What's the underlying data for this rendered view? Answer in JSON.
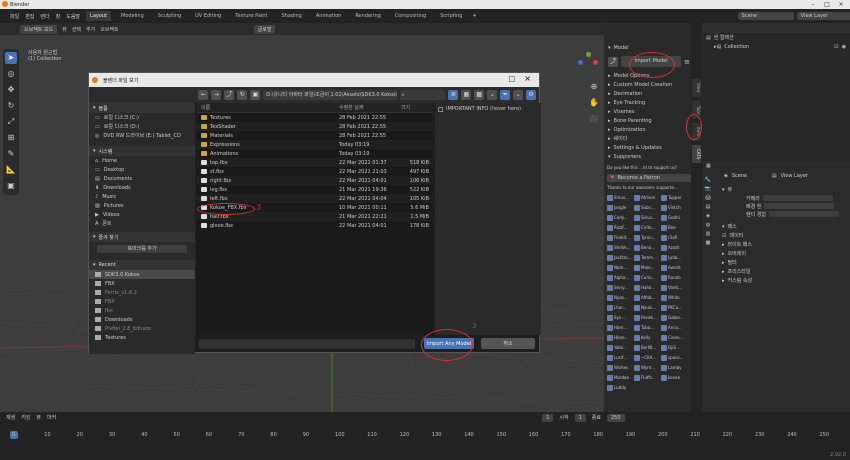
{
  "app": {
    "title": "Blender"
  },
  "menu": {
    "items": [
      "파일",
      "편집",
      "렌더",
      "창",
      "도움말"
    ],
    "tabs": [
      "Layout",
      "Modeling",
      "Sculpting",
      "UV Editing",
      "Texture Paint",
      "Shading",
      "Animation",
      "Rendering",
      "Compositing",
      "Scripting"
    ],
    "active": "Layout",
    "scene": "Scene",
    "view_layer": "View Layer"
  },
  "viewport": {
    "header": [
      "오브젝트 모드",
      "뷰",
      "선택",
      "추가",
      "오브젝트",
      "글로벌"
    ],
    "label_line1": "사용자 원근법",
    "label_line2": "(1) Collection"
  },
  "toolbar_icons": [
    "select-icon",
    "cursor-icon",
    "move-icon",
    "rotate-icon",
    "scale-icon",
    "transform-icon",
    "annotate-icon",
    "measure-icon",
    "add-cube-icon"
  ],
  "dialog": {
    "title": "블렌더 파일 보기",
    "path": "D:\\유니티 아바타 파일\\조금이 1.01\\Assets\\SDK3.0 Kokos\\",
    "side_sections": {
      "volumes": "볼륨",
      "system": "시스템",
      "favorites": "즐겨 찾기",
      "add_favorite": "북마크를 추가",
      "recent": "Recent"
    },
    "volumes": [
      "로컬 디스크 (C:)",
      "로컬 디스크 (D:)",
      "DVD RW 드라이브 (E:) Tablet_CD"
    ],
    "system": [
      "Home",
      "Desktop",
      "Documents",
      "Downloads",
      "Music",
      "Pictures",
      "Videos",
      "폰트"
    ],
    "recent": [
      "SDK3.0 Kokos",
      "FBX",
      "Ferris_v1.8.2",
      "FBX",
      "fbx",
      "Downloads",
      "Pivfiel_2.8_bdnaze",
      "Textures"
    ],
    "columns": {
      "name": "이름",
      "date": "수정한 날짜",
      "size": "크기"
    },
    "files": [
      {
        "name": "Textures",
        "date": "28 Feb 2021 22:55",
        "size": "",
        "type": "folder"
      },
      {
        "name": "TexShader",
        "date": "28 Feb 2021 22:55",
        "size": "",
        "type": "folder"
      },
      {
        "name": "Materials",
        "date": "28 Feb 2021 22:55",
        "size": "",
        "type": "folder"
      },
      {
        "name": "Expressions",
        "date": "Today 03:19",
        "size": "",
        "type": "folder"
      },
      {
        "name": "Animations",
        "date": "Today 03:19",
        "size": "",
        "type": "folder"
      },
      {
        "name": "top.fbx",
        "date": "22 Mar 2021 01:37",
        "size": "518 KiB",
        "type": "file"
      },
      {
        "name": "st.fbx",
        "date": "22 Mar 2021 21:03",
        "size": "497 KiB",
        "type": "file"
      },
      {
        "name": "right.fbx",
        "date": "22 Mar 2021 04:01",
        "size": "106 KiB",
        "type": "file"
      },
      {
        "name": "leg.fbx",
        "date": "21 Mar 2021 19:36",
        "size": "522 KiB",
        "type": "file"
      },
      {
        "name": "left.fbx",
        "date": "22 Mar 2021 04:04",
        "size": "105 KiB",
        "type": "file"
      },
      {
        "name": "Kokoe_FBX.fbx",
        "date": "10 Mar 2021 00:11",
        "size": "5.6 MiB",
        "type": "file"
      },
      {
        "name": "hair.fbx",
        "date": "21 Mar 2021 22:21",
        "size": "1.5 MiB",
        "type": "file"
      },
      {
        "name": "glove.fbx",
        "date": "22 Mar 2021 04:01",
        "size": "178 KiB",
        "type": "file"
      }
    ],
    "option": "IMPORTANT INFO (hover here)",
    "import_btn": "Import Any Model",
    "cancel_btn": "취소"
  },
  "npanel": {
    "model": "Model",
    "import_model": "Import Model",
    "sections": [
      "Model Options",
      "Custom Model Creation",
      "Decimation",
      "Eye Tracking",
      "Visemes",
      "Bone Parenting",
      "Optimization",
      "쉐이더",
      "Settings & Updates",
      "Supporters"
    ],
    "support_q": "Do you like this ...nt to support us?",
    "patreon": "Become a Patron",
    "thanks": "Thanks to our awesome supporte...",
    "supporters": [
      "Sirius...",
      "Atrixon",
      "Tupper",
      "Jangle",
      "Subc...",
      "Vintch",
      "Cody...",
      "Sirius...",
      "Godhi",
      "RizzF...",
      "Cirite...",
      "Bee",
      "Firekit...",
      "Tyron...",
      "r3xR",
      "Shrikh...",
      "Bena...",
      "Azuth",
      "Jacktro...",
      "Tomm...",
      "Lyda...",
      "Nam...",
      "Mule...",
      "Awrint",
      "Alpha...",
      "Curio...",
      "Runda",
      "Serry...",
      "Haha...",
      "Vanit...",
      "Nyas...",
      "Affob...",
      "Whito",
      "Lhur...",
      "Nyuki...",
      "PKCa...",
      "Syn...",
      "Pavak...",
      "Gaber...",
      "Ham...",
      "Tabo...",
      "Anco...",
      "Hiroe...",
      "Kelly",
      "Cinev...",
      "Yako...",
      "BertB...",
      "DjGi...",
      "Lucif...",
      "~CKA...",
      "space...",
      "Wishes",
      "Wynt...",
      "Lamby",
      "Mordae",
      "Fluffs...",
      "konan",
      "Luddy"
    ],
    "tabs": [
      "CATS",
      "Item",
      "Tool",
      "View"
    ]
  },
  "outliner": {
    "scene_collection": "씬 컬렉션",
    "collection": "Collection"
  },
  "properties": {
    "scene": "Scene",
    "view_layer": "View Layer",
    "section_view": "뷰",
    "camera": "카메라",
    "background": "배경 흰",
    "render": "렌더 경험",
    "passes": "패스",
    "data": "데이터",
    "light_path": "라이트 패스",
    "overlay": "오버레이",
    "filter": "필터",
    "freestyle": "프리스타일",
    "denoise": "디노이즈",
    "post": "커스텀 속성",
    "use": "사용"
  },
  "timeline": {
    "menus": [
      "재생",
      "키잉",
      "뷰",
      "마커"
    ],
    "ticks": [
      "0",
      "10",
      "20",
      "30",
      "40",
      "50",
      "60",
      "70",
      "80",
      "90",
      "100",
      "110",
      "120",
      "130",
      "140",
      "150",
      "160",
      "170",
      "180",
      "190",
      "200",
      "210",
      "220",
      "230",
      "240",
      "250"
    ],
    "start_label": "시작",
    "start": "1",
    "end_label": "종료",
    "end": "250",
    "frame": "1",
    "version": "2.92.0"
  },
  "colors": {
    "accent": "#4772b3",
    "annotation": "#d83030",
    "folder": "#c9a54a"
  }
}
